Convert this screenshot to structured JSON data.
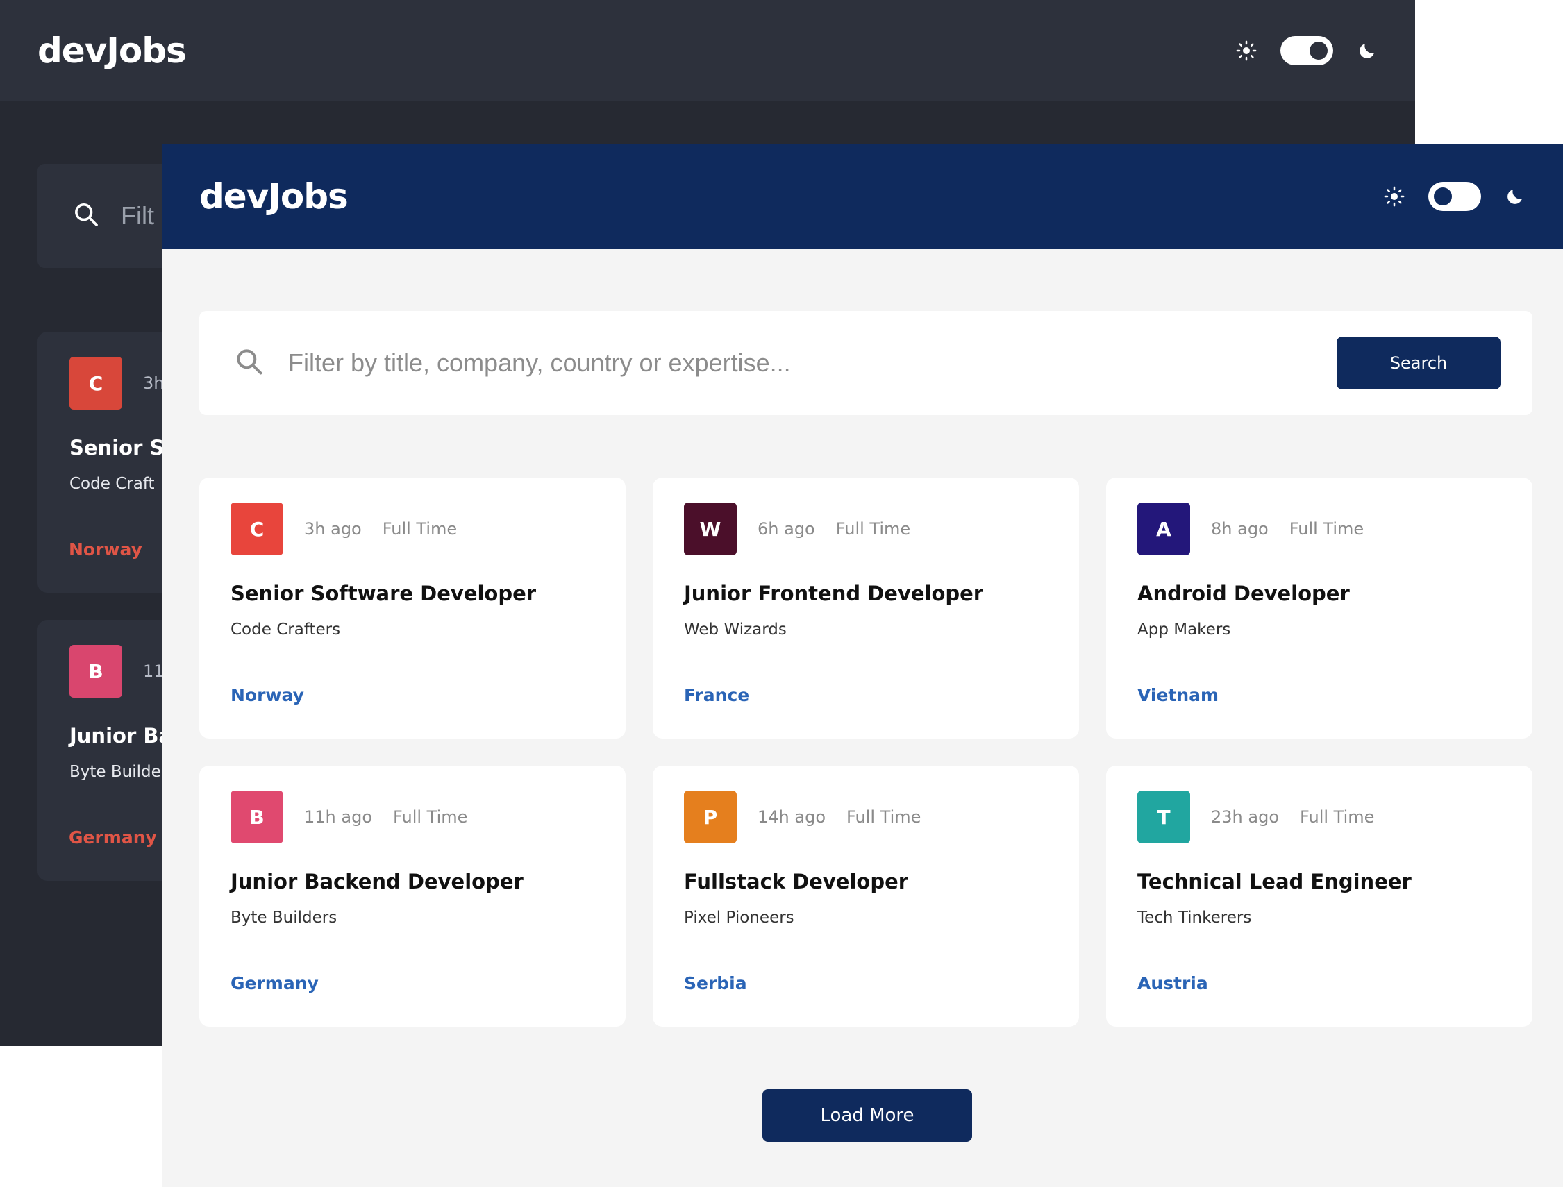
{
  "brand": "devJobs",
  "colors": {
    "light_header": "#0f2a5d",
    "dark_bg": "#262932",
    "dark_card": "#2d313c",
    "country_light": "#2a64b6",
    "country_dark": "#e05546",
    "button": "#0f2a5d"
  },
  "icons": {
    "sun": "sun-icon",
    "moon": "moon-icon",
    "search": "search-icon"
  },
  "dark_window": {
    "theme": "dark",
    "search": {
      "placeholder_visible": "Filt"
    },
    "cards": [
      {
        "letter": "C",
        "posted": "3h",
        "title": "Senior So",
        "company": "Code Craft",
        "country": "Norway",
        "logo_color": "#d8473a"
      },
      {
        "letter": "B",
        "posted": "11h",
        "title": "Junior Ba",
        "company": "Byte Builde",
        "country": "Germany",
        "logo_color": "#d9466e"
      }
    ]
  },
  "light_window": {
    "theme": "light",
    "search": {
      "placeholder": "Filter by title, company, country or expertise...",
      "button_label": "Search"
    },
    "jobs": [
      {
        "letter": "C",
        "posted": "3h ago",
        "type": "Full Time",
        "title": "Senior Software Developer",
        "company": "Code Crafters",
        "country": "Norway",
        "logo_color": "#e8453c"
      },
      {
        "letter": "W",
        "posted": "6h ago",
        "type": "Full Time",
        "title": "Junior Frontend Developer",
        "company": "Web Wizards",
        "country": "France",
        "logo_color": "#4b0f2a"
      },
      {
        "letter": "A",
        "posted": "8h ago",
        "type": "Full Time",
        "title": "Android Developer",
        "company": "App Makers",
        "country": "Vietnam",
        "logo_color": "#23177a"
      },
      {
        "letter": "B",
        "posted": "11h ago",
        "type": "Full Time",
        "title": "Junior Backend Developer",
        "company": "Byte Builders",
        "country": "Germany",
        "logo_color": "#e0496f"
      },
      {
        "letter": "P",
        "posted": "14h ago",
        "type": "Full Time",
        "title": "Fullstack Developer",
        "company": "Pixel Pioneers",
        "country": "Serbia",
        "logo_color": "#e57f1e"
      },
      {
        "letter": "T",
        "posted": "23h ago",
        "type": "Full Time",
        "title": "Technical Lead Engineer",
        "company": "Tech Tinkerers",
        "country": "Austria",
        "logo_color": "#21a6a0"
      }
    ],
    "load_more_label": "Load More"
  }
}
